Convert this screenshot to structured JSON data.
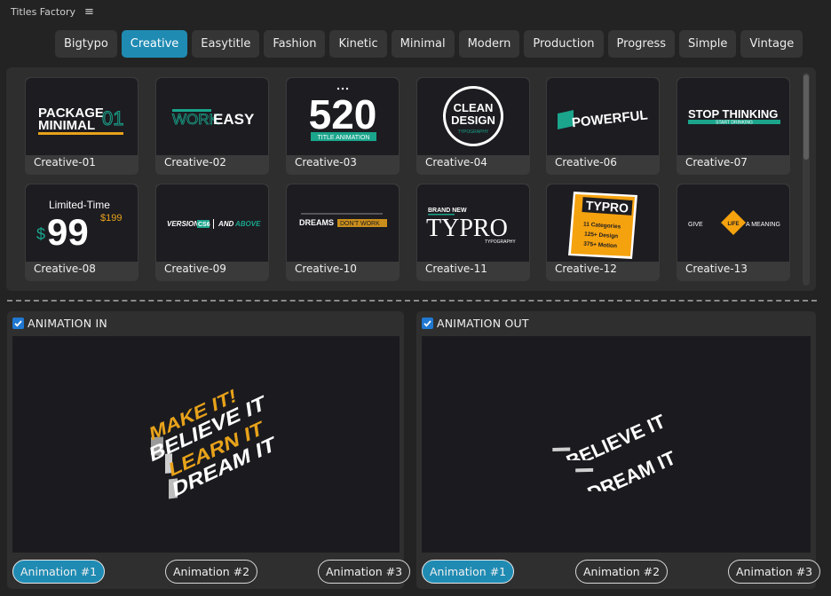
{
  "app": {
    "title": "Titles Factory"
  },
  "tabs": [
    {
      "label": "Bigtypo"
    },
    {
      "label": "Creative",
      "active": true
    },
    {
      "label": "Easytitle"
    },
    {
      "label": "Fashion"
    },
    {
      "label": "Kinetic"
    },
    {
      "label": "Minimal"
    },
    {
      "label": "Modern"
    },
    {
      "label": "Production"
    },
    {
      "label": "Progress"
    },
    {
      "label": "Simple"
    },
    {
      "label": "Vintage"
    }
  ],
  "gallery": {
    "items": [
      {
        "label": "Creative-01",
        "art": [
          "PACKAGE",
          "MINIMAL",
          "01"
        ]
      },
      {
        "label": "Creative-02",
        "art": [
          "WORK",
          "EASY"
        ]
      },
      {
        "label": "Creative-03",
        "art": [
          "520",
          "TITLE ANIMATION"
        ]
      },
      {
        "label": "Creative-04",
        "art": [
          "CLEAN",
          "DESIGN",
          "TYPOGRAPHY"
        ]
      },
      {
        "label": "Creative-06",
        "art": [
          "POWERFUL"
        ]
      },
      {
        "label": "Creative-07",
        "art": [
          "STOP THINKING",
          "START DRINKING"
        ]
      },
      {
        "label": "Creative-08",
        "art": [
          "Limited-Time",
          "99",
          "$199",
          "$"
        ]
      },
      {
        "label": "Creative-09",
        "art": [
          "VERSION",
          "CS6",
          "AND",
          "ABOVE"
        ]
      },
      {
        "label": "Creative-10",
        "art": [
          "DREAMS",
          "DON'T WORK"
        ]
      },
      {
        "label": "Creative-11",
        "art": [
          "BRAND NEW",
          "TYPRO",
          "TYPOGRAPHY"
        ]
      },
      {
        "label": "Creative-12",
        "art": [
          "TYPRO",
          "11 Categories",
          "125+ Design",
          "375+ Motion"
        ]
      },
      {
        "label": "Creative-13",
        "art": [
          "GIVE",
          "LIFE",
          "A MEANING"
        ]
      }
    ]
  },
  "animation_in": {
    "label": "ANIMATION IN",
    "checked": true,
    "art": [
      "MAKE IT!",
      "BELIEVE IT",
      "LEARN IT",
      "DREAM IT"
    ],
    "buttons": [
      {
        "label": "Animation #1",
        "active": true
      },
      {
        "label": "Animation #2"
      },
      {
        "label": "Animation #3"
      }
    ]
  },
  "animation_out": {
    "label": "ANIMATION OUT",
    "checked": true,
    "art": [
      "BELIEVE IT",
      "DREAM IT"
    ],
    "buttons": [
      {
        "label": "Animation #1",
        "active": true
      },
      {
        "label": "Animation #2"
      },
      {
        "label": "Animation #3"
      }
    ]
  },
  "colors": {
    "accent": "#1f8bb3",
    "checkbox": "#1f78d1",
    "gold": "#e8a21a",
    "teal": "#1aa58c"
  }
}
